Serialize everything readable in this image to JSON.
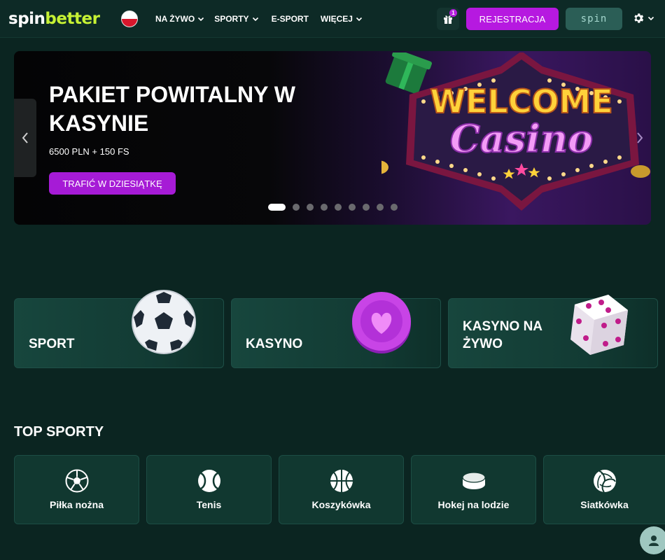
{
  "header": {
    "logo_part1": "spin",
    "logo_part2": "better",
    "language": "PL",
    "nav": [
      {
        "label": "NA ŻYWO",
        "has_dropdown": true
      },
      {
        "label": "SPORTY",
        "has_dropdown": true
      },
      {
        "label": "E-SPORT",
        "has_dropdown": false
      },
      {
        "label": "WIĘCEJ",
        "has_dropdown": true
      }
    ],
    "gift_badge": "1",
    "register_label": "REJESTRACJA",
    "login_label": "spin"
  },
  "banner": {
    "title": "PAKIET POWITALNY W KASYNIE",
    "subtitle": "6500 PLN + 150 FS",
    "cta_label": "TRAFIĆ W DZIESIĄTKĘ",
    "sign_line1": "WELCOME",
    "sign_line2": "Casino",
    "slide_count": 9,
    "active_slide": 1
  },
  "categories": [
    {
      "label": "SPORT",
      "icon": "soccer-ball-icon"
    },
    {
      "label": "KASYNO",
      "icon": "casino-chip-icon"
    },
    {
      "label": "KASYNO NA ŻYWO",
      "icon": "dice-icon"
    }
  ],
  "top_sports": {
    "title": "TOP SPORTY",
    "items": [
      {
        "label": "Piłka nożna",
        "icon": "football-icon"
      },
      {
        "label": "Tenis",
        "icon": "tennis-icon"
      },
      {
        "label": "Koszykówka",
        "icon": "basketball-icon"
      },
      {
        "label": "Hokej na lodzie",
        "icon": "ice-hockey-icon"
      },
      {
        "label": "Siatkówka",
        "icon": "volleyball-icon"
      }
    ]
  },
  "colors": {
    "background": "#0b2521",
    "accent_purple": "#b619e0",
    "logo_green": "#c6f134",
    "card": "#113830"
  }
}
